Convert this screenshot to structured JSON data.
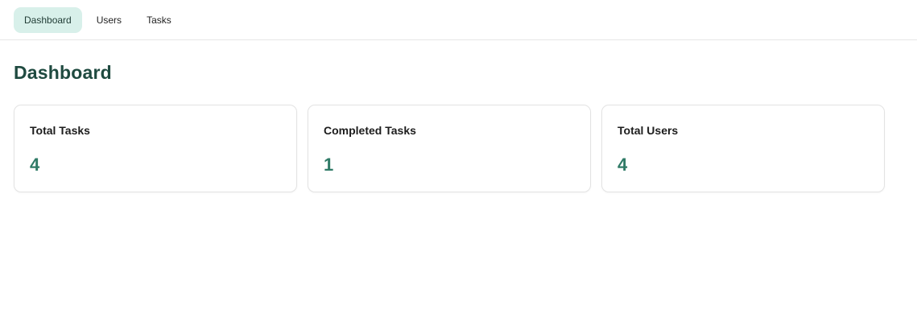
{
  "nav": {
    "tabs": [
      {
        "label": "Dashboard",
        "active": true
      },
      {
        "label": "Users",
        "active": false
      },
      {
        "label": "Tasks",
        "active": false
      }
    ]
  },
  "page": {
    "title": "Dashboard"
  },
  "stats": [
    {
      "label": "Total Tasks",
      "value": "4"
    },
    {
      "label": "Completed Tasks",
      "value": "1"
    },
    {
      "label": "Total Users",
      "value": "4"
    }
  ],
  "colors": {
    "accent": "#2f7a66",
    "title": "#1f4a40",
    "active_tab_bg": "#d8f0ea"
  }
}
